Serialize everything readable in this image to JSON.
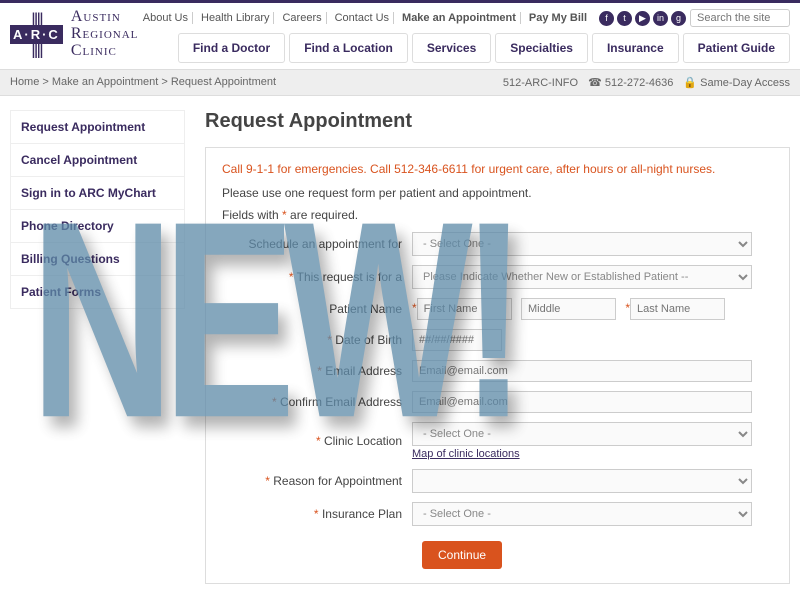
{
  "top": {
    "links": [
      "About Us",
      "Health Library",
      "Careers",
      "Contact Us",
      "Make an Appointment",
      "Pay My Bill"
    ],
    "searchPlaceholder": "Search the site"
  },
  "logo": {
    "line1": "Austin",
    "line2": "Regional",
    "line3": "Clinic",
    "mark": "A·R·C"
  },
  "nav": [
    "Find a Doctor",
    "Find a Location",
    "Services",
    "Specialties",
    "Insurance",
    "Patient Guide"
  ],
  "bread": {
    "home": "Home",
    "l1": "Make an Appointment",
    "l2": "Request Appointment"
  },
  "sub": {
    "info": "512-ARC-INFO",
    "phone": "512-272-4636",
    "same": "Same-Day Access"
  },
  "side": [
    "Request Appointment",
    "Cancel Appointment",
    "Sign in to ARC MyChart",
    "Phone Directory",
    "Billing Questions",
    "Patient Forms"
  ],
  "h1": "Request Appointment",
  "emerg": "Call 9-1-1 for emergencies. Call 512-346-6611 for urgent care, after hours or all-night nurses.",
  "instr": "Please use one request form per patient and appointment.",
  "reqnote1": "Fields with ",
  "reqnote2": " are required.",
  "labels": {
    "sched": "Schedule an appointment for",
    "isfor": "This request is for a",
    "pname": "Patient Name",
    "dob": "Date of Birth",
    "email": "Email Address",
    "cemail": "Confirm Email Address",
    "clinic": "Clinic Location",
    "reason": "Reason for Appointment",
    "ins": "Insurance Plan"
  },
  "ph": {
    "select": "- Select One -",
    "indicate": "Please Indicate Whether New or Established Patient --",
    "fname": "First Name",
    "mname": "Middle",
    "lname": "Last Name",
    "dob": "##/##/####",
    "email": "Email@email.com"
  },
  "maplink": "Map of clinic locations",
  "continue": "Continue",
  "overlay": "NEW!"
}
